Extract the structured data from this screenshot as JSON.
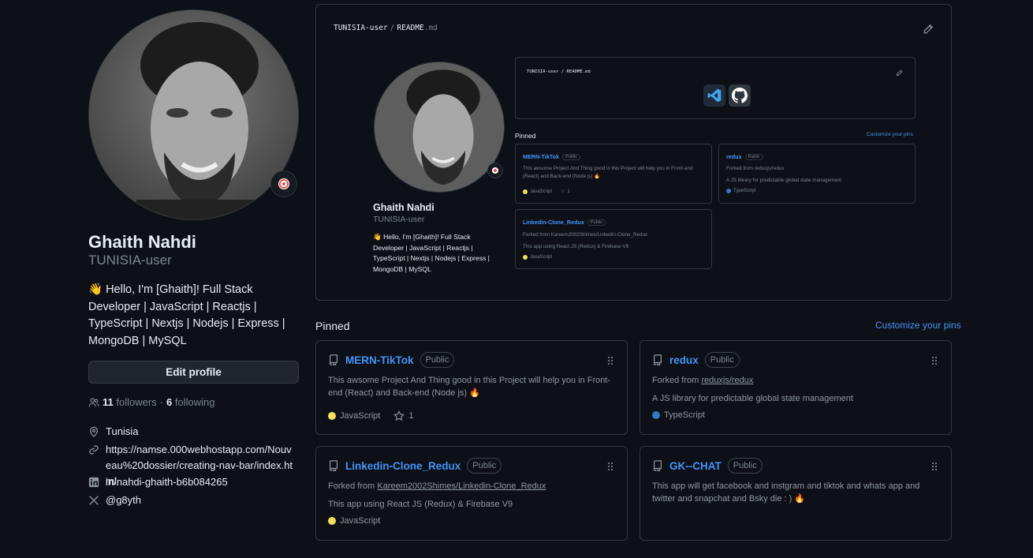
{
  "profile": {
    "name": "Ghaith Nahdi",
    "login": "TUNISIA-user",
    "bio": "👋 Hello, I'm [Ghaith]! Full Stack Developer | JavaScript | Reactjs | TypeScript | Nextjs | Nodejs | Express | MongoDB | MySQL",
    "edit_button": "Edit profile",
    "followers_count": "11",
    "followers_label": "followers",
    "dot": "·",
    "following_count": "6",
    "following_label": "following",
    "location": "Tunisia",
    "website": "https://namse.000webhostapp.com/Nouveau%20dossier/creating-nav-bar/index.html",
    "linkedin": "in/nahdi-ghaith-b6b084265",
    "twitter": "@g8yth"
  },
  "readme": {
    "path_user": "TUNISIA-user",
    "path_sep": "/",
    "path_file": "README",
    "path_ext": ".md"
  },
  "pinned": {
    "title": "Pinned",
    "customize": "Customize your pins",
    "cards": [
      {
        "name": "MERN-TikTok",
        "visibility": "Public",
        "description": "This awsome Project And Thing good in this Project will help you in Front-end (React) and Back-end (Node js) 🔥",
        "language": "JavaScript",
        "lang_color": "#f1e05a",
        "stars": "1"
      },
      {
        "name": "redux",
        "visibility": "Public",
        "forked_prefix": "Forked from ",
        "forked_from": "reduxjs/redux",
        "description": "A JS library for predictable global state management",
        "language": "TypeScript",
        "lang_color": "#3178c6"
      },
      {
        "name": "Linkedin-Clone_Redux",
        "visibility": "Public",
        "forked_prefix": "Forked from ",
        "forked_from": "Kareem2002Shimes/Linkedin-Clone_Redux",
        "description": "This app using React JS (Redux) & Firebase V9",
        "language": "JavaScript",
        "lang_color": "#f1e05a"
      },
      {
        "name": "GK--CHAT",
        "visibility": "Public",
        "description": "This app will get facebook and instgram and tiktok and whats app and twitter and snapchat and Bsky die : ) 🔥"
      }
    ]
  },
  "mini": {
    "name": "Ghaith Nahdi",
    "login": "TUNISIA-user",
    "bio": "👋 Hello, I'm [Ghaith]! Full Stack Developer | JavaScript | Reactjs | TypeScript | Nextjs | Nodejs | Express | MongoDB | MySQL",
    "path": "TUNISIA-user / README.md",
    "pinned_title": "Pinned",
    "customize": "Customize your pins",
    "cards": [
      {
        "name": "MERN-TikTok",
        "visibility": "Public",
        "description": "This awsome Project And Thing good in this Project will help you in Front-end (React) and Back-end (Node js) 🔥",
        "language": "JavaScript",
        "stars": "1"
      },
      {
        "name": "redux",
        "visibility": "Public",
        "forked": "Forked from reduxjs/redux",
        "description": "A JS library for predictable global state management",
        "language": "TypeScript"
      },
      {
        "name": "Linkedin-Clone_Redux",
        "visibility": "Public",
        "forked": "Forked from Kareem2002Shimes/Linkedin-Clone_Redux",
        "description": "This app using React JS (Redux) & Firebase V9",
        "language": "JavaScript"
      }
    ]
  },
  "icons": {
    "status": "dartboard-icon",
    "vscode": "vscode-icon",
    "github": "github-icon"
  },
  "colors": {
    "background": "#0d1117",
    "border": "#30363d",
    "link": "#4493f8",
    "muted": "#7d8590",
    "javascript": "#f1e05a",
    "typescript": "#3178c6"
  }
}
